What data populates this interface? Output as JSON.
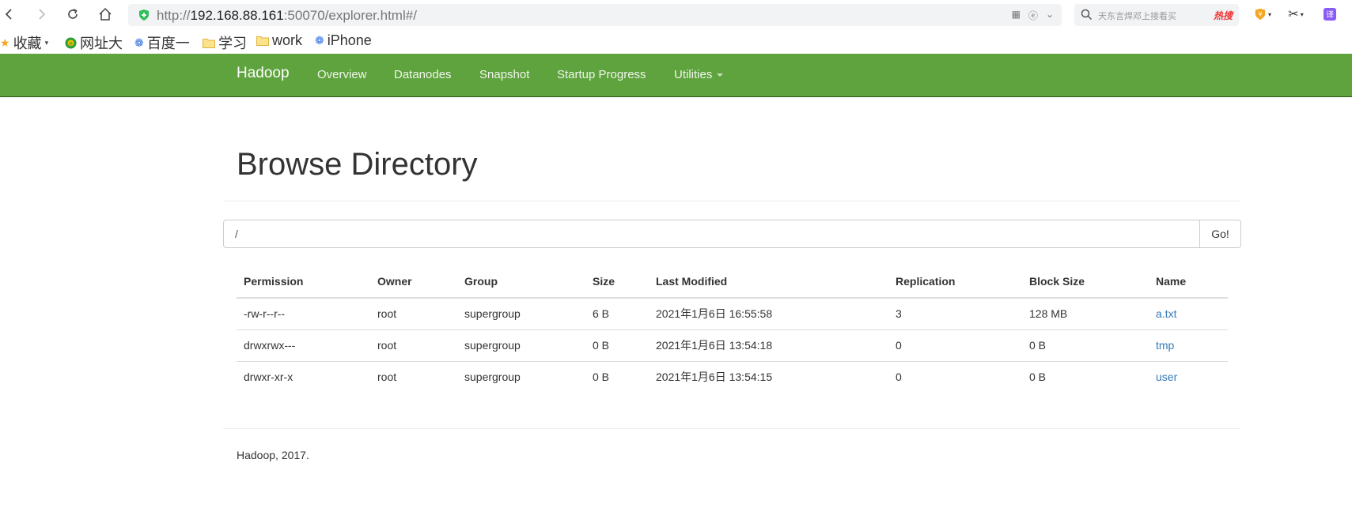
{
  "browser": {
    "url_prefix": "http://",
    "url_host": "192.168.88.161",
    "url_rest": ":50070/explorer.html#/",
    "search_placeholder": "天东言焊邓上接看买",
    "search_hot": "热搜"
  },
  "bookmarks": [
    {
      "label": "收藏",
      "icon": "star-icon"
    },
    {
      "label": "网址大",
      "icon": "globe-icon"
    },
    {
      "label": "百度一",
      "icon": "baidu-paw-icon"
    },
    {
      "label": "学习",
      "icon": "folder-icon"
    },
    {
      "label": "work",
      "icon": "folder-icon"
    },
    {
      "label": "iPhone",
      "icon": "baidu-paw-icon"
    }
  ],
  "navbar": {
    "brand": "Hadoop",
    "links": [
      "Overview",
      "Datanodes",
      "Snapshot",
      "Startup Progress",
      "Utilities"
    ]
  },
  "main": {
    "title": "Browse Directory",
    "path_value": "/",
    "go_label": "Go!"
  },
  "table": {
    "headers": [
      "Permission",
      "Owner",
      "Group",
      "Size",
      "Last Modified",
      "Replication",
      "Block Size",
      "Name"
    ],
    "rows": [
      [
        "-rw-r--r--",
        "root",
        "supergroup",
        "6 B",
        "2021年1月6日 16:55:58",
        "3",
        "128 MB",
        "a.txt"
      ],
      [
        "drwxrwx---",
        "root",
        "supergroup",
        "0 B",
        "2021年1月6日 13:54:18",
        "0",
        "0 B",
        "tmp"
      ],
      [
        "drwxr-xr-x",
        "root",
        "supergroup",
        "0 B",
        "2021年1月6日 13:54:15",
        "0",
        "0 B",
        "user"
      ]
    ]
  },
  "footer": {
    "text": "Hadoop, 2017."
  },
  "colors": {
    "navbar_bg": "#5fa33e",
    "link": "#337ab7"
  }
}
